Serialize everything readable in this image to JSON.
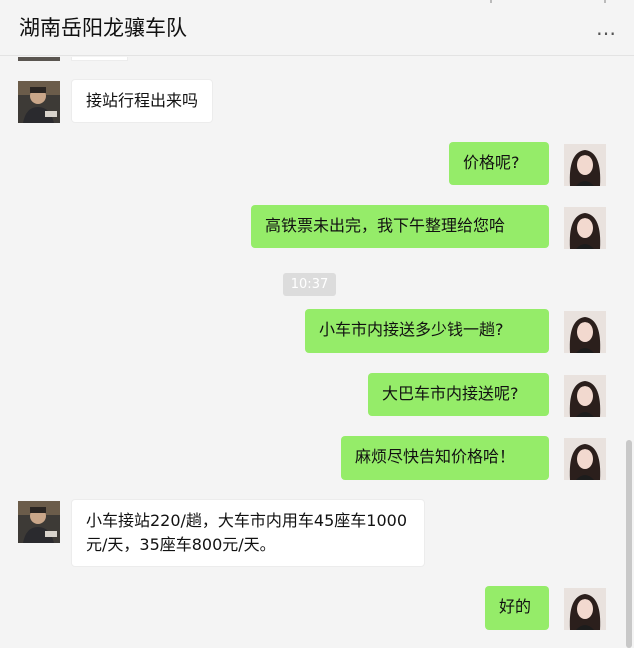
{
  "header": {
    "title": "湖南岳阳龙骧车队",
    "more_glyph": "…"
  },
  "messages": [
    {
      "side": "in",
      "text": "接站行程出来吗"
    },
    {
      "side": "out",
      "text": "价格呢?"
    },
    {
      "side": "out",
      "text": "高铁票未出完，我下午整理给您哈"
    },
    {
      "side": "out",
      "text": "小车市内接送多少钱一趟?"
    },
    {
      "side": "out",
      "text": "大巴车市内接送呢?"
    },
    {
      "side": "out",
      "text": "麻烦尽快告知价格哈！"
    },
    {
      "side": "in",
      "text": "小车接站220/趟，大车市内用车45座车1000元/天，35座车800元/天。"
    },
    {
      "side": "out",
      "text": "好的"
    }
  ],
  "timestamp": "10:37",
  "colors": {
    "background": "#f4f4f4",
    "outgoing_bubble": "#95ec69",
    "incoming_bubble": "#ffffff"
  },
  "icons": {
    "more": "more-options-icon"
  }
}
